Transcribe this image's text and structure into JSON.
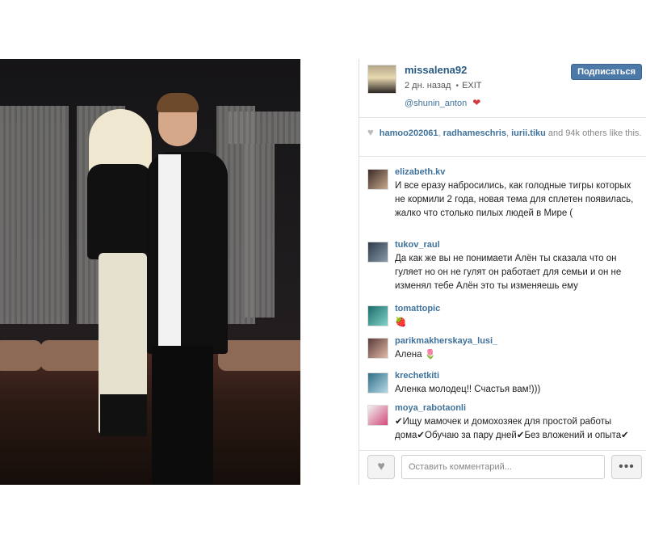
{
  "post": {
    "username": "missalena92",
    "time_ago": "2 дн. назад",
    "location": "EXIT",
    "tagged_user": "@shunin_anton",
    "heart_glyph": "❤",
    "follow_label": "Подписаться",
    "colors": {
      "accent": "#4d79a8",
      "username": "#2b5a83",
      "link": "#3f729b"
    }
  },
  "likes": {
    "users": [
      "hamoo202061",
      "radhameschris",
      "iurii.tiku"
    ],
    "separator": ", ",
    "suffix": " and 94k others like this."
  },
  "comments": [
    {
      "user": "elizabeth.kv",
      "text": "И все еразу набросились, как голодные тигры которых не кормили 2 года, новая тема для сплетен появилась, жалко что столько пилых людей в Мире ("
    },
    {
      "user": "tukov_raul",
      "text": "Да как же вы не понимаети Алён ты сказала что он гуляет но он не гулят он работает для семьи и он не изменял тебе Алён это ты изменяешь ему"
    },
    {
      "user": "tomattopic",
      "text": "🍓"
    },
    {
      "user": "parikmakherskaya_lusi_",
      "text": "Алена 🌷"
    },
    {
      "user": "krechetkiti",
      "text": "Аленка молодец!! Счастья вам!)))"
    },
    {
      "user": "moya_rabotaonli",
      "text": "✔Ищу мамочек и домохозяек для простой работы дома✔Обучаю за пару дней✔Без вложений и опыта✔"
    }
  ],
  "footer": {
    "comment_placeholder": "Оставить комментарий...",
    "like_icon": "heart-icon",
    "more_label": "•••"
  }
}
